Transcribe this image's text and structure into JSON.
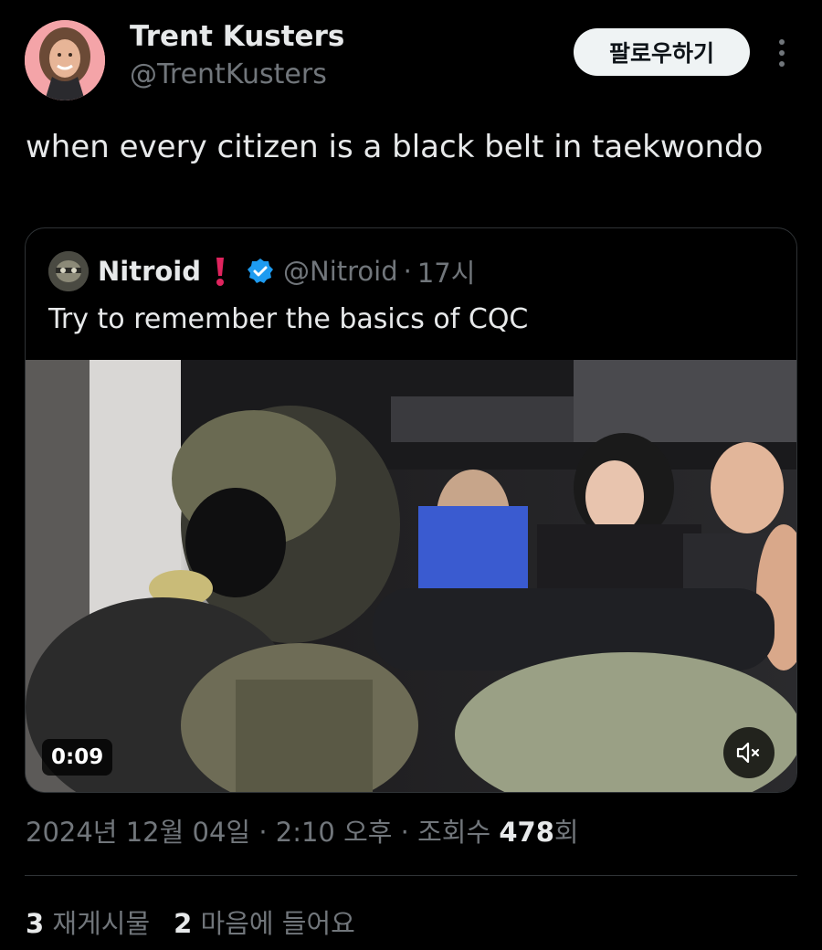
{
  "author": {
    "name": "Trent Kusters",
    "handle": "@TrentKusters",
    "follow_label": "팔로우하기"
  },
  "tweet": {
    "text": "when every citizen is a black belt in taekwondo"
  },
  "quote": {
    "name": "Nitroid",
    "emoji": "❗",
    "verified": true,
    "handle": "@Nitroid",
    "separator": "·",
    "time": "17시",
    "text": "Try to remember the basics of CQC",
    "video": {
      "duration": "0:09",
      "muted": true
    }
  },
  "meta": {
    "date": "2024년 12월 04일",
    "sep1": "·",
    "time": "2:10 오후",
    "sep2": "·",
    "views_label": "조회수",
    "views_count": "478",
    "views_suffix": "회"
  },
  "stats": {
    "reposts_count": "3",
    "reposts_label": "재게시물",
    "likes_count": "2",
    "likes_label": "마음에 들어요"
  },
  "colors": {
    "background": "#000000",
    "text": "#e7e9ea",
    "secondary": "#71767b",
    "verified": "#1d9bf0",
    "emoji": "#e0245e"
  }
}
